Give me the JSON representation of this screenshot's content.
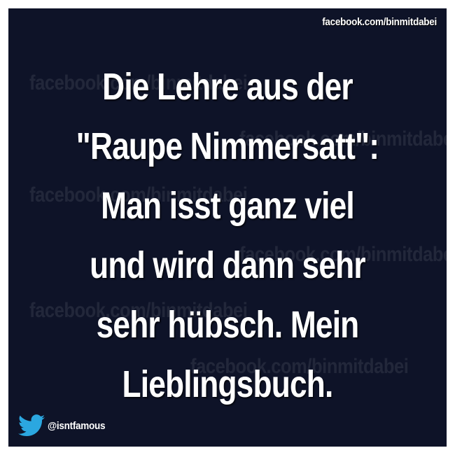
{
  "header": {
    "source_link": "facebook.com/binmitdabei"
  },
  "watermarks": [
    "facebook.com/binmitdabei"
  ],
  "quote": {
    "lines": [
      "Die Lehre aus der",
      "\"Raupe Nimmersatt\":",
      "Man isst ganz viel",
      "und wird dann sehr",
      "sehr hübsch. Mein",
      "Lieblingsbuch."
    ]
  },
  "footer": {
    "icon": "twitter-bird-icon",
    "handle": "@isntfamous"
  },
  "colors": {
    "background": "#0e1328",
    "border": "#ffffff",
    "text": "#ffffff",
    "twitter_blue": "#2ba7e0"
  }
}
